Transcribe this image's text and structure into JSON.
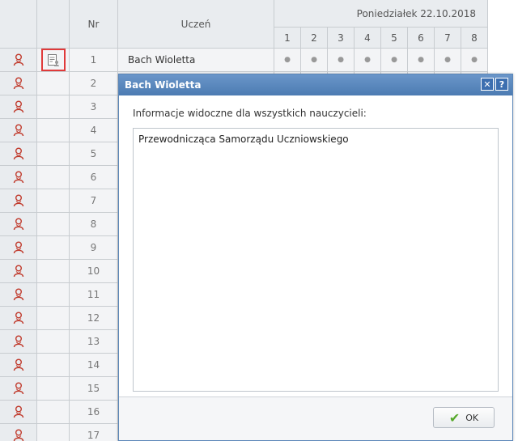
{
  "header": {
    "nr": "Nr",
    "student": "Uczeń",
    "day": "Poniedziałek 22.10.2018",
    "lessons": [
      "1",
      "2",
      "3",
      "4",
      "5",
      "6",
      "7",
      "8"
    ]
  },
  "rows": [
    {
      "nr": "1",
      "name": "Bach Wioletta",
      "has_note": true
    },
    {
      "nr": "2"
    },
    {
      "nr": "3"
    },
    {
      "nr": "4"
    },
    {
      "nr": "5"
    },
    {
      "nr": "6"
    },
    {
      "nr": "7"
    },
    {
      "nr": "8"
    },
    {
      "nr": "9"
    },
    {
      "nr": "10"
    },
    {
      "nr": "11"
    },
    {
      "nr": "12"
    },
    {
      "nr": "13"
    },
    {
      "nr": "14"
    },
    {
      "nr": "15"
    },
    {
      "nr": "16"
    },
    {
      "nr": "17"
    }
  ],
  "attendance_mark": "●",
  "dialog": {
    "title": "Bach Wioletta",
    "close_symbol": "✕",
    "help_symbol": "?",
    "label": "Informacje widoczne dla wszystkich nauczycieli:",
    "text": "Przewodnicząca Samorządu Uczniowskiego",
    "ok_label": "OK",
    "ok_icon": "✔"
  },
  "icons": {
    "student": "person-icon",
    "note": "note-icon"
  },
  "colors": {
    "highlight_border": "#e03a3a",
    "title_bar": "#4c7bb2"
  }
}
